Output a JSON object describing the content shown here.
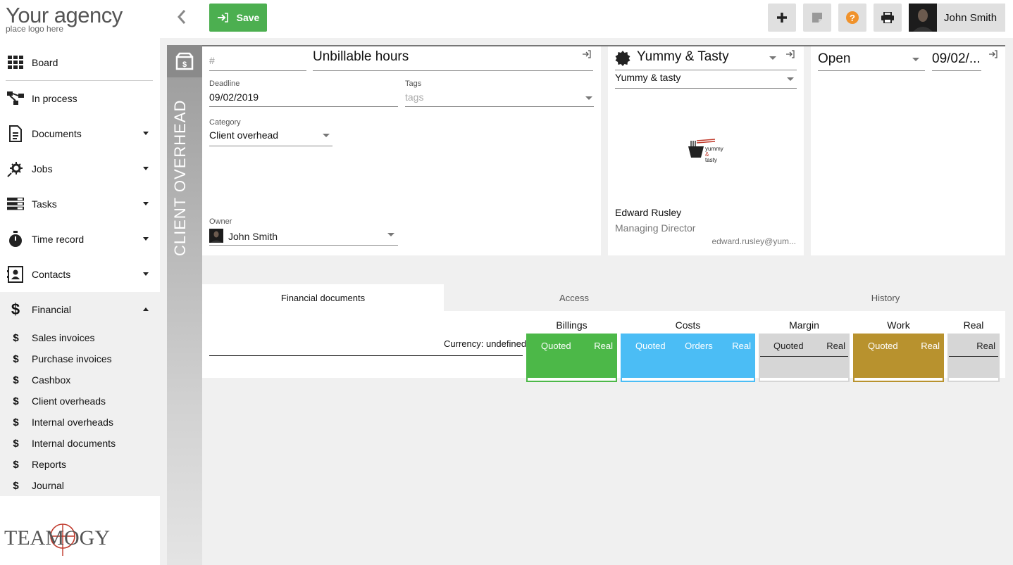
{
  "brand": {
    "title": "Your agency",
    "subtitle": "place logo here"
  },
  "nav": [
    {
      "label": "Board",
      "icon": "grid-icon"
    },
    {
      "label": "In process",
      "icon": "flow-icon"
    },
    {
      "label": "Documents",
      "icon": "document-icon"
    },
    {
      "label": "Jobs",
      "icon": "gear-icon"
    },
    {
      "label": "Tasks",
      "icon": "list-icon"
    },
    {
      "label": "Time record",
      "icon": "stopwatch-icon"
    },
    {
      "label": "Contacts",
      "icon": "contact-card-icon"
    },
    {
      "label": "Financial",
      "icon": "dollar-icon"
    }
  ],
  "financial_sub": [
    "Sales invoices",
    "Purchase invoices",
    "Cashbox",
    "Client overheads",
    "Internal overheads",
    "Internal documents",
    "Reports",
    "Journal"
  ],
  "toolbar": {
    "save_label": "Save",
    "user_name": "John Smith"
  },
  "record": {
    "type_label": "CLIENT OVERHEAD",
    "number_placeholder": "#",
    "title": "Unbillable hours",
    "deadline_label": "Deadline",
    "deadline": "09/02/2019",
    "tags_label": "Tags",
    "tags_placeholder": "tags",
    "category_label": "Category",
    "category": "Client overhead",
    "owner_label": "Owner",
    "owner": "John Smith"
  },
  "client": {
    "company": "Yummy & Tasty",
    "subcompany": "Yummy & tasty",
    "contact_name": "Edward Rusley",
    "contact_role": "Managing Director",
    "contact_email": "edward.rusley@yum...",
    "logo_text": [
      "yummy",
      "&",
      "tasty"
    ]
  },
  "status": {
    "state": "Open",
    "date": "09/02/..."
  },
  "tabs": [
    "Financial documents",
    "Access",
    "History"
  ],
  "finance": {
    "currency": "Currency: undefined",
    "groups": [
      {
        "title": "Billings",
        "cols": [
          "Quoted",
          "Real"
        ],
        "color": "#4cb848"
      },
      {
        "title": "Costs",
        "cols": [
          "Quoted",
          "Orders",
          "Real"
        ],
        "color": "#4bbdf5"
      },
      {
        "title": "Margin",
        "cols": [
          "Quoted",
          "Real"
        ],
        "color": "#d6d6d6"
      },
      {
        "title": "Work",
        "cols": [
          "Quoted",
          "Real"
        ],
        "color": "#b8922e"
      },
      {
        "title": "Real",
        "cols": [
          "Real"
        ],
        "color": "#d6d6d6"
      }
    ]
  },
  "footer_logo": "TEAMOGY"
}
